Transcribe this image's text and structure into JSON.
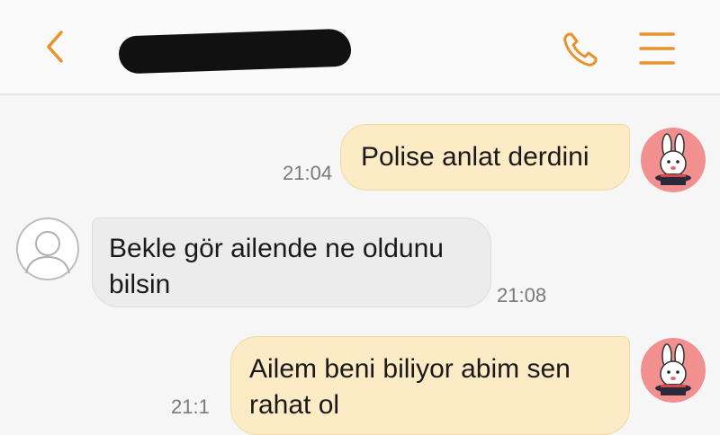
{
  "header": {
    "back_icon": "chevron-left-icon",
    "contact_name": "",
    "call_icon": "phone-icon",
    "menu_icon": "menu-icon",
    "accent_color": "#e8922c"
  },
  "messages": [
    {
      "direction": "outgoing",
      "text": "Polise anlat derdini",
      "time": "21:04",
      "avatar": "bunny-avatar"
    },
    {
      "direction": "incoming",
      "text": "Bekle gör ailende ne oldunu bilsin",
      "time": "21:08",
      "avatar": "default-user-avatar"
    },
    {
      "direction": "outgoing",
      "text": "Ailem beni biliyor abim sen rahat ol",
      "time": "21:1",
      "avatar": "bunny-avatar"
    }
  ]
}
